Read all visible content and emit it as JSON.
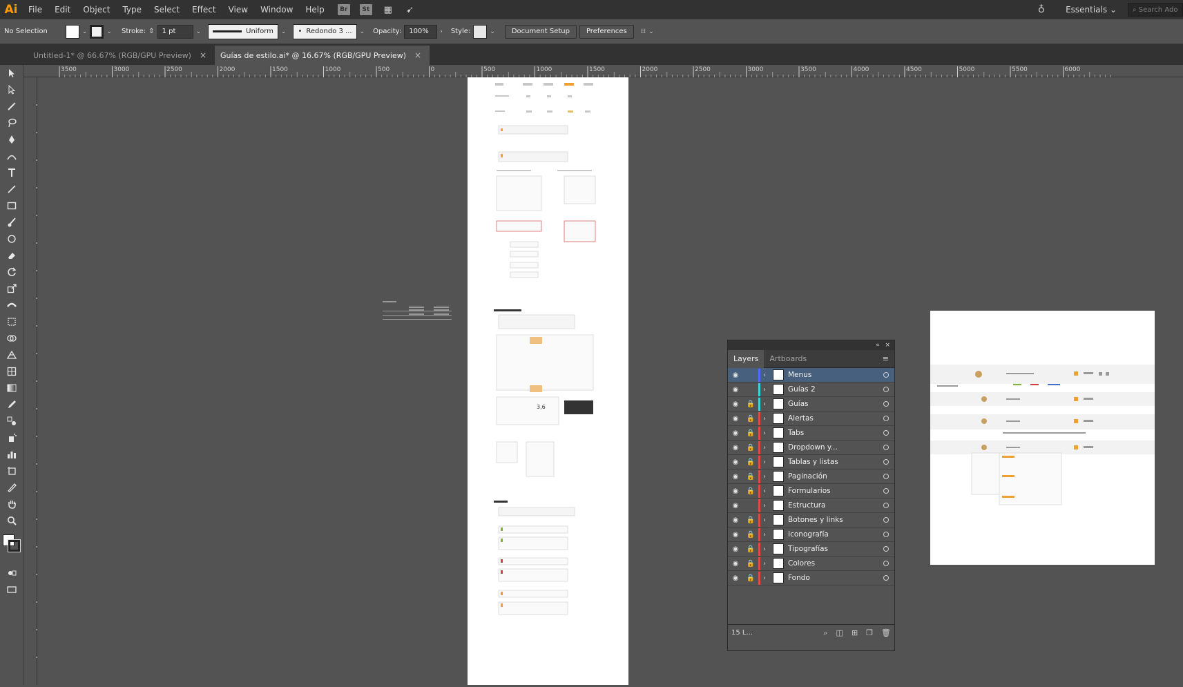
{
  "app": {
    "logo": "Ai",
    "menus": [
      "File",
      "Edit",
      "Object",
      "Type",
      "Select",
      "Effect",
      "View",
      "Window",
      "Help"
    ],
    "bridge": "Br",
    "stock": "St",
    "workspace": "Essentials",
    "search_placeholder": "Search Ado"
  },
  "control": {
    "selection": "No Selection",
    "stroke_label": "Stroke:",
    "stroke_weight": "1 pt",
    "stroke_profile": "Uniform",
    "brush": "Redondo 3 ...",
    "opacity_label": "Opacity:",
    "opacity": "100%",
    "style_label": "Style:",
    "document_setup": "Document Setup",
    "preferences": "Preferences"
  },
  "tabs": [
    {
      "label": "Untitled-1* @ 66.67% (RGB/GPU Preview)",
      "active": false
    },
    {
      "label": "Guías de estilo.ai* @ 16.67% (RGB/GPU Preview)",
      "active": true
    }
  ],
  "ruler": {
    "top_labels": [
      "3500",
      "3000",
      "2500",
      "2000",
      "1500",
      "1000",
      "500",
      "0",
      "500",
      "1000",
      "1500",
      "2000",
      "2500",
      "3000",
      "3500",
      "4000",
      "4500",
      "5000",
      "5500",
      "6000"
    ]
  },
  "layers_panel": {
    "tabs": [
      "Layers",
      "Artboards"
    ],
    "count": "15 L...",
    "layers": [
      {
        "name": "Menus",
        "color": "#4f6bff",
        "locked": false,
        "selected": true
      },
      {
        "name": "Guías 2",
        "color": "#3bd7d7",
        "locked": false,
        "selected": false
      },
      {
        "name": "Guías",
        "color": "#3bd7d7",
        "locked": true,
        "selected": false
      },
      {
        "name": "Alertas",
        "color": "#e04a4a",
        "locked": true,
        "selected": false
      },
      {
        "name": "Tabs",
        "color": "#e04a4a",
        "locked": true,
        "selected": false
      },
      {
        "name": "Dropdown y...",
        "color": "#e04a4a",
        "locked": true,
        "selected": false
      },
      {
        "name": "Tablas y listas",
        "color": "#e04a4a",
        "locked": true,
        "selected": false
      },
      {
        "name": "Paginación",
        "color": "#e04a4a",
        "locked": true,
        "selected": false
      },
      {
        "name": "Formularios",
        "color": "#e04a4a",
        "locked": true,
        "selected": false
      },
      {
        "name": "Estructura",
        "color": "#e04a4a",
        "locked": false,
        "selected": false
      },
      {
        "name": "Botones y links",
        "color": "#e04a4a",
        "locked": true,
        "selected": false
      },
      {
        "name": "Iconografía",
        "color": "#e04a4a",
        "locked": true,
        "selected": false
      },
      {
        "name": "Tipografías",
        "color": "#e04a4a",
        "locked": true,
        "selected": false
      },
      {
        "name": "Colores",
        "color": "#e04a4a",
        "locked": true,
        "selected": false
      },
      {
        "name": "Fondo",
        "color": "#e04a4a",
        "locked": true,
        "selected": false
      }
    ]
  }
}
